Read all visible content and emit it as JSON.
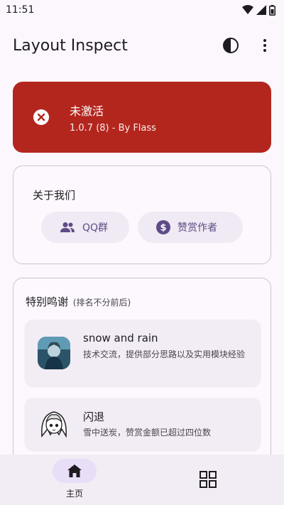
{
  "status_bar": {
    "time": "11:51"
  },
  "app_bar": {
    "title": "Layout Inspect",
    "theme_icon": "contrast-icon",
    "menu_icon": "more-vert-icon"
  },
  "activation": {
    "title": "未激活",
    "subtitle": "1.0.7 (8) - By Flass",
    "icon": "error-x-icon",
    "color": "#b3261e"
  },
  "about": {
    "title": "关于我们",
    "qq_label": "QQ群",
    "donate_label": "赞赏作者"
  },
  "thanks": {
    "title": "特别鸣谢",
    "note": "(排名不分前后)",
    "items": [
      {
        "name": "snow and rain",
        "desc": "技术交流，提供部分思路以及实用模块经验"
      },
      {
        "name": "闪退",
        "desc": "雪中送炭，赞赏金额已超过四位数"
      }
    ]
  },
  "bottom_nav": {
    "home_label": "主页"
  },
  "colors": {
    "accent": "#5e4b86",
    "background": "#fcf7fd",
    "nav_active": "#e8def8"
  }
}
